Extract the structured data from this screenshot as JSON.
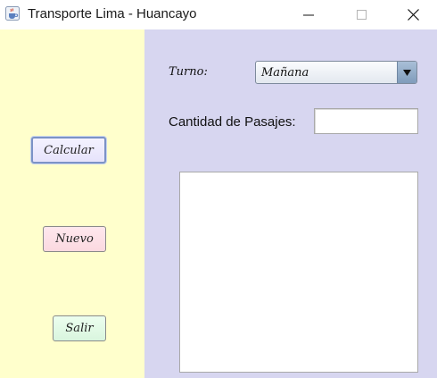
{
  "window": {
    "title": "Transporte Lima - Huancayo",
    "icons": {
      "app": "java-cup-icon",
      "minimize": "minimize-icon",
      "maximize": "maximize-icon",
      "close": "close-icon"
    }
  },
  "colors": {
    "left_panel": "#ffffcc",
    "right_panel": "#d7d6f0",
    "calcular_button": "#ece9fd",
    "nuevo_button": "#fde0e6",
    "salir_button": "#e2f8e5"
  },
  "buttons": {
    "calcular": "Calcular",
    "nuevo": "Nuevo",
    "salir": "Salir"
  },
  "form": {
    "turno_label": "Turno:",
    "turno_selected": "Mañana",
    "cantidad_label": "Cantidad de Pasajes:",
    "cantidad_value": "",
    "output_text": ""
  }
}
